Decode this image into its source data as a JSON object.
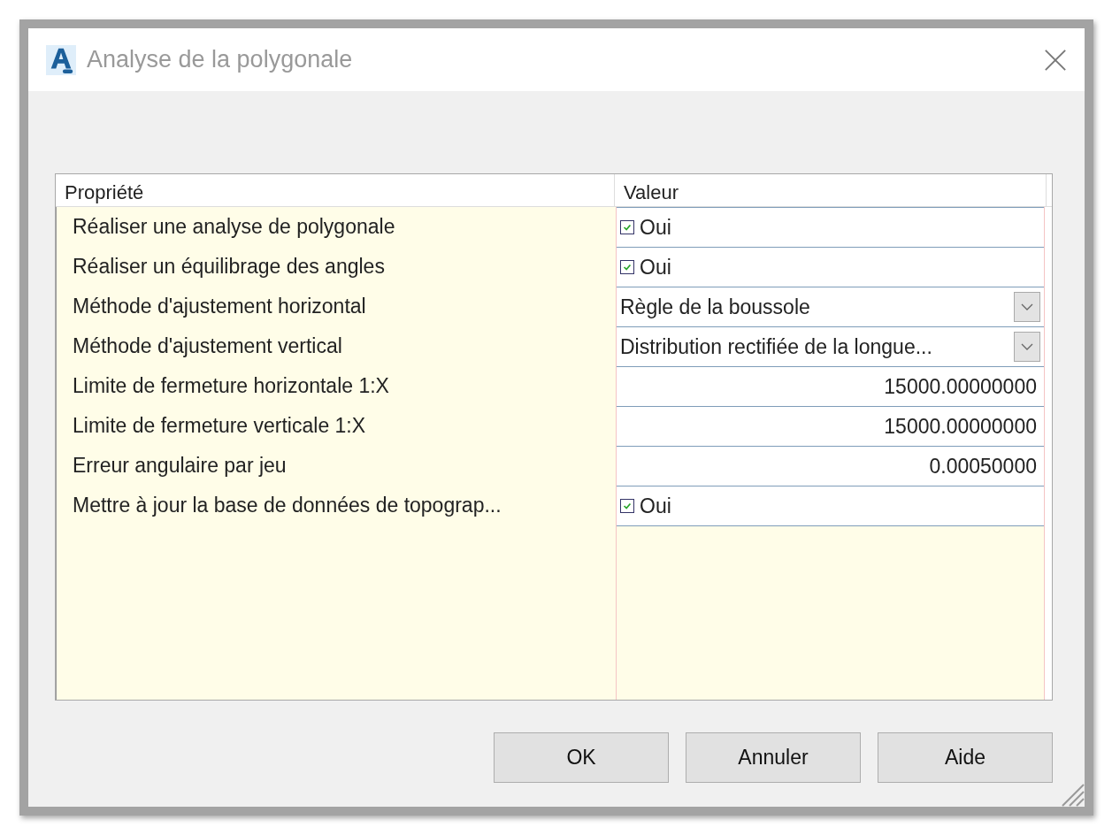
{
  "window": {
    "title": "Analyse de la polygonale"
  },
  "table": {
    "columns": [
      "Propriété",
      "Valeur"
    ],
    "rows": [
      {
        "property": "Réaliser une analyse de polygonale",
        "kind": "checkbox",
        "value": "Oui",
        "checked": true
      },
      {
        "property": "Réaliser un équilibrage des angles",
        "kind": "checkbox",
        "value": "Oui",
        "checked": true
      },
      {
        "property": "Méthode d'ajustement horizontal",
        "kind": "dropdown",
        "value": "Règle de la boussole"
      },
      {
        "property": "Méthode d'ajustement vertical",
        "kind": "dropdown",
        "value": "Distribution rectifiée de la longue..."
      },
      {
        "property": "Limite de fermeture horizontale 1:X",
        "kind": "number",
        "value": "15000.00000000"
      },
      {
        "property": "Limite de fermeture verticale 1:X",
        "kind": "number",
        "value": "15000.00000000"
      },
      {
        "property": "Erreur angulaire par jeu",
        "kind": "number",
        "value": "0.00050000"
      },
      {
        "property": "Mettre à jour la base de données de topograp...",
        "kind": "checkbox",
        "value": "Oui",
        "checked": true
      }
    ]
  },
  "buttons": [
    "OK",
    "Annuler",
    "Aide"
  ]
}
